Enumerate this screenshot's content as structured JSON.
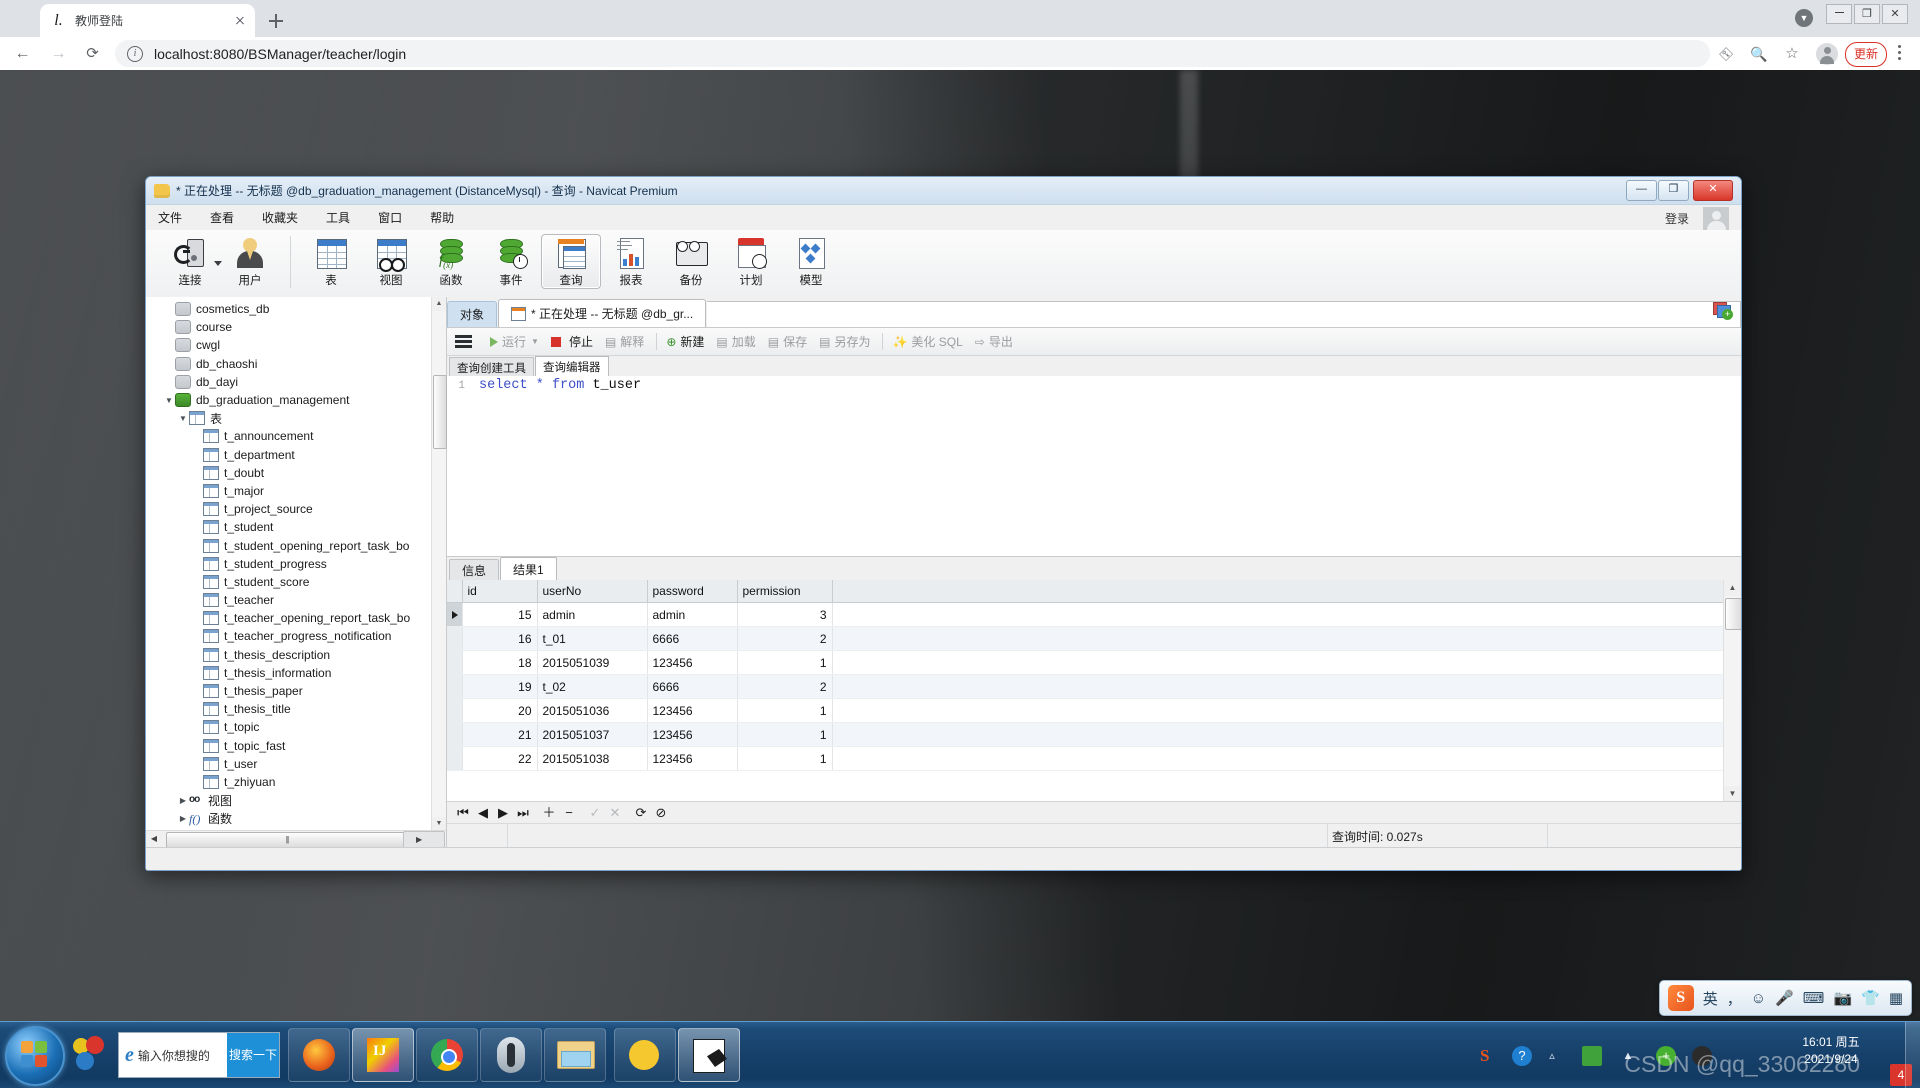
{
  "browser": {
    "tab": {
      "title": "教师登陆",
      "favicon": "browser-favicon",
      "close": "×"
    },
    "newtab_label": "+",
    "url": "localhost:8080/BSManager/teacher/login",
    "back": "←",
    "forward": "→",
    "reload": "⟳",
    "icons": {
      "key": "⚷",
      "zoom": "🔍",
      "star": "☆",
      "menu": "⋮"
    },
    "update_label": "更新",
    "window": {
      "minimize": "—",
      "maximize": "❐",
      "close": "✕",
      "caret": "▼"
    }
  },
  "navicat": {
    "title": "* 正在处理 -- 无标题 @db_graduation_management (DistanceMysql) - 查询 - Navicat Premium",
    "window_buttons": {
      "minimize": "—",
      "maximize": "❐",
      "close": "✕"
    },
    "menus": [
      "文件",
      "查看",
      "收藏夹",
      "工具",
      "窗口",
      "帮助"
    ],
    "login_label": "登录",
    "toolbar": [
      {
        "label": "连接",
        "icon": "connect-icon",
        "has_dropdown": true
      },
      {
        "label": "用户",
        "icon": "user-icon"
      },
      {
        "label": "表",
        "icon": "table-icon"
      },
      {
        "label": "视图",
        "icon": "view-icon"
      },
      {
        "label": "函数",
        "icon": "function-icon"
      },
      {
        "label": "事件",
        "icon": "event-icon"
      },
      {
        "label": "查询",
        "icon": "query-icon",
        "selected": true
      },
      {
        "label": "报表",
        "icon": "report-icon"
      },
      {
        "label": "备份",
        "icon": "backup-icon"
      },
      {
        "label": "计划",
        "icon": "schedule-icon"
      },
      {
        "label": "模型",
        "icon": "model-icon"
      }
    ],
    "tree": [
      {
        "label": "cosmetics_db",
        "indent": 1,
        "icon": "database-icon",
        "expander": ""
      },
      {
        "label": "course",
        "indent": 1,
        "icon": "database-icon",
        "expander": ""
      },
      {
        "label": "cwgl",
        "indent": 1,
        "icon": "database-icon",
        "expander": ""
      },
      {
        "label": "db_chaoshi",
        "indent": 1,
        "icon": "database-icon",
        "expander": ""
      },
      {
        "label": "db_dayi",
        "indent": 1,
        "icon": "database-icon",
        "expander": ""
      },
      {
        "label": "db_graduation_management",
        "indent": 1,
        "icon": "database-icon-active",
        "expander": "▼"
      },
      {
        "label": "表",
        "indent": 2,
        "icon": "table-folder-icon",
        "expander": "▼"
      },
      {
        "label": "t_announcement",
        "indent": 3,
        "icon": "table-icon",
        "expander": ""
      },
      {
        "label": "t_department",
        "indent": 3,
        "icon": "table-icon",
        "expander": ""
      },
      {
        "label": "t_doubt",
        "indent": 3,
        "icon": "table-icon",
        "expander": ""
      },
      {
        "label": "t_major",
        "indent": 3,
        "icon": "table-icon",
        "expander": ""
      },
      {
        "label": "t_project_source",
        "indent": 3,
        "icon": "table-icon",
        "expander": ""
      },
      {
        "label": "t_student",
        "indent": 3,
        "icon": "table-icon",
        "expander": ""
      },
      {
        "label": "t_student_opening_report_task_bo",
        "indent": 3,
        "icon": "table-icon",
        "expander": ""
      },
      {
        "label": "t_student_progress",
        "indent": 3,
        "icon": "table-icon",
        "expander": ""
      },
      {
        "label": "t_student_score",
        "indent": 3,
        "icon": "table-icon",
        "expander": ""
      },
      {
        "label": "t_teacher",
        "indent": 3,
        "icon": "table-icon",
        "expander": ""
      },
      {
        "label": "t_teacher_opening_report_task_bo",
        "indent": 3,
        "icon": "table-icon",
        "expander": ""
      },
      {
        "label": "t_teacher_progress_notification",
        "indent": 3,
        "icon": "table-icon",
        "expander": ""
      },
      {
        "label": "t_thesis_description",
        "indent": 3,
        "icon": "table-icon",
        "expander": ""
      },
      {
        "label": "t_thesis_information",
        "indent": 3,
        "icon": "table-icon",
        "expander": ""
      },
      {
        "label": "t_thesis_paper",
        "indent": 3,
        "icon": "table-icon",
        "expander": ""
      },
      {
        "label": "t_thesis_title",
        "indent": 3,
        "icon": "table-icon",
        "expander": ""
      },
      {
        "label": "t_topic",
        "indent": 3,
        "icon": "table-icon",
        "expander": ""
      },
      {
        "label": "t_topic_fast",
        "indent": 3,
        "icon": "table-icon",
        "expander": ""
      },
      {
        "label": "t_user",
        "indent": 3,
        "icon": "table-icon",
        "expander": ""
      },
      {
        "label": "t_zhiyuan",
        "indent": 3,
        "icon": "table-icon",
        "expander": ""
      },
      {
        "label": "视图",
        "indent": 2,
        "icon": "view-folder-icon",
        "expander": "▶"
      },
      {
        "label": "函数",
        "indent": 2,
        "icon": "function-folder-icon",
        "expander": "▶"
      }
    ],
    "content_tabs": [
      {
        "label": "对象",
        "type": "objects"
      },
      {
        "label": "* 正在处理 -- 无标题 @db_gr...",
        "type": "query",
        "active": true
      }
    ],
    "query_toolbar": [
      {
        "label": "运行",
        "icon": "run-icon",
        "disabled": true,
        "dropdown": true
      },
      {
        "label": "停止",
        "icon": "stop-icon",
        "disabled": false
      },
      {
        "label": "解释",
        "icon": "explain-icon",
        "disabled": true
      },
      {
        "label": "新建",
        "icon": "new-icon",
        "disabled": false
      },
      {
        "label": "加载",
        "icon": "load-icon",
        "disabled": true
      },
      {
        "label": "保存",
        "icon": "save-icon",
        "disabled": true
      },
      {
        "label": "另存为",
        "icon": "save-as-icon",
        "disabled": true
      },
      {
        "label": "美化 SQL",
        "icon": "beautify-icon",
        "disabled": true
      },
      {
        "label": "导出",
        "icon": "export-icon",
        "disabled": true
      }
    ],
    "query_subtabs": [
      {
        "label": "查询创建工具",
        "active": false
      },
      {
        "label": "查询编辑器",
        "active": true
      }
    ],
    "editor": {
      "line_number": "1",
      "sql_keyword1": "select",
      "sql_star": "*",
      "sql_keyword2": "from",
      "sql_table": "t_user"
    },
    "result_tabs": [
      {
        "label": "信息",
        "active": false
      },
      {
        "label": "结果1",
        "active": true
      }
    ],
    "grid": {
      "columns": [
        "id",
        "userNo",
        "password",
        "permission"
      ],
      "rows": [
        {
          "id": "15",
          "userNo": "admin",
          "password": "admin",
          "permission": "3",
          "current": true
        },
        {
          "id": "16",
          "userNo": "t_01",
          "password": "6666",
          "permission": "2",
          "current": false
        },
        {
          "id": "18",
          "userNo": "2015051039",
          "password": "123456",
          "permission": "1",
          "current": false
        },
        {
          "id": "19",
          "userNo": "t_02",
          "password": "6666",
          "permission": "2",
          "current": false
        },
        {
          "id": "20",
          "userNo": "2015051036",
          "password": "123456",
          "permission": "1",
          "current": false
        },
        {
          "id": "21",
          "userNo": "2015051037",
          "password": "123456",
          "permission": "1",
          "current": false
        },
        {
          "id": "22",
          "userNo": "2015051038",
          "password": "123456",
          "permission": "1",
          "current": false
        }
      ]
    },
    "record_nav": [
      "⏮",
      "◀",
      "▶",
      "⏭",
      "＋",
      "−",
      "✓",
      "✕",
      "⟳",
      "⊘"
    ],
    "status": {
      "query_time": "查询时间: 0.027s"
    }
  },
  "taskbar": {
    "ie_search": {
      "placeholder": "输入你想搜的",
      "button": "搜索一下"
    },
    "clock": {
      "time": "16:01 周五",
      "date": "2021/9/24"
    },
    "ime": {
      "logo": "S",
      "mode": "英",
      "items": [
        "，",
        "☺",
        "🎤",
        "⌨",
        "📷",
        "👕",
        "▦"
      ]
    },
    "tray_badge": "4",
    "watermark": "CSDN @qq_33062280"
  }
}
